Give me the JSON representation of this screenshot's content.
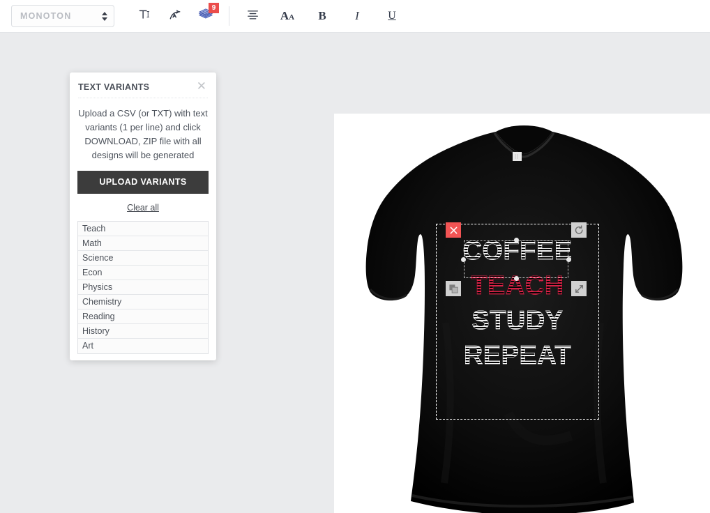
{
  "toolbar": {
    "font_select": {
      "value": "MONOTON",
      "icon": "spinner-arrows"
    },
    "buttons": [
      {
        "name": "text-tool-button",
        "icon": "text-cursor-icon",
        "label": "T"
      },
      {
        "name": "curve-text-button",
        "icon": "curved-text-icon",
        "label": ""
      },
      {
        "name": "layers-button",
        "icon": "layers-stack-icon",
        "label": "",
        "badge": "9"
      },
      {
        "name": "align-button",
        "icon": "align-center-icon",
        "label": ""
      },
      {
        "name": "font-size-button",
        "icon": "font-size-icon",
        "label": "Aa"
      },
      {
        "name": "bold-button",
        "icon": "bold-icon",
        "label": "B"
      },
      {
        "name": "italic-button",
        "icon": "italic-icon",
        "label": "I"
      },
      {
        "name": "underline-button",
        "icon": "underline-icon",
        "label": "U"
      }
    ]
  },
  "variants_panel": {
    "title": "TEXT VARIANTS",
    "close_icon": "✕",
    "description": "Upload a CSV (or TXT) with text variants (1 per line) and click DOWNLOAD, ZIP file with all designs will be generated",
    "upload_button": "UPLOAD VARIANTS",
    "clear_all": "Clear all",
    "items": [
      "Teach",
      "Math",
      "Science",
      "Econ",
      "Physics",
      "Chemistry",
      "Reading",
      "History",
      "Art"
    ]
  },
  "canvas": {
    "product": "black-t-shirt",
    "design": {
      "lines": [
        {
          "text": "COFFEE",
          "color": "#d8d8d8",
          "selected": false
        },
        {
          "text": "TEACH",
          "color": "#d62246",
          "selected": true
        },
        {
          "text": "STUDY",
          "color": "#d8d8d8",
          "selected": false
        },
        {
          "text": "REPEAT",
          "color": "#d8d8d8",
          "selected": false
        }
      ],
      "selection_handles": {
        "delete": "✕",
        "rotate": "↺",
        "duplicate": "⧉",
        "resize": "⤡"
      }
    }
  },
  "colors": {
    "accent_red": "#d62246",
    "badge_red": "#eb4d4b",
    "delete_red": "#f25454",
    "workspace_bg": "#eaebed",
    "button_dark": "#3c3c3c"
  }
}
